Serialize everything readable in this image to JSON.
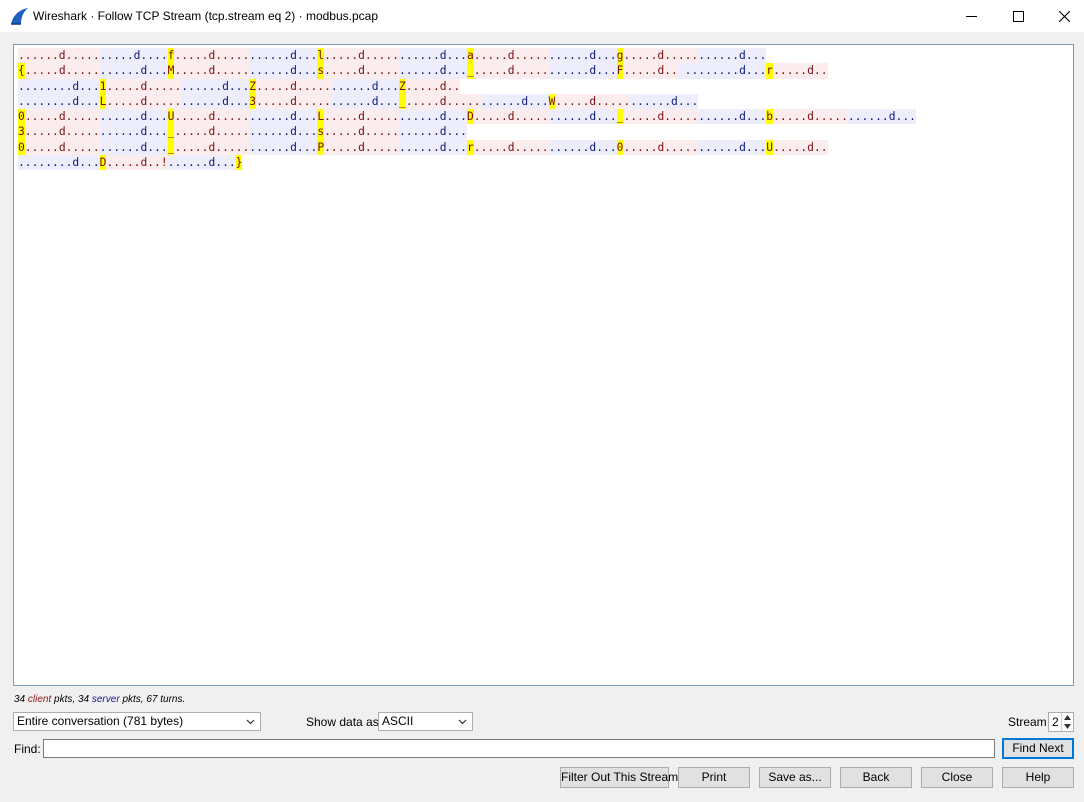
{
  "window": {
    "title": "Wireshark · Follow TCP Stream (tcp.stream eq 2) · modbus.pcap",
    "brand_color": "#1f5fbf"
  },
  "stream": {
    "lines": [
      [
        {
          "d": "c",
          "t": "......d....."
        },
        {
          "d": "s",
          "t": ".....d...."
        },
        {
          "d": "c",
          "t": "f"
        },
        {
          "d": "c",
          "t": ".....d....."
        },
        {
          "d": "s",
          "t": "......d..."
        },
        {
          "d": "c",
          "t": "l"
        },
        {
          "d": "c",
          "t": ".....d....."
        },
        {
          "d": "s",
          "t": "......d..."
        },
        {
          "d": "c",
          "t": "a"
        },
        {
          "d": "c",
          "t": ".....d....."
        },
        {
          "d": "s",
          "t": "......d..."
        },
        {
          "d": "c",
          "t": "g"
        },
        {
          "d": "c",
          "t": ".....d....."
        },
        {
          "d": "s",
          "t": "......d..."
        }
      ],
      [
        {
          "d": "c",
          "t": "{"
        },
        {
          "d": "c",
          "t": ".....d....."
        },
        {
          "d": "s",
          "t": "......d..."
        },
        {
          "d": "c",
          "t": "M"
        },
        {
          "d": "c",
          "t": ".....d....."
        },
        {
          "d": "s",
          "t": "......d..."
        },
        {
          "d": "c",
          "t": "s"
        },
        {
          "d": "c",
          "t": ".....d....."
        },
        {
          "d": "s",
          "t": "......d..."
        },
        {
          "d": "c",
          "t": "_"
        },
        {
          "d": "c",
          "t": ".....d....."
        },
        {
          "d": "s",
          "t": "......d..."
        },
        {
          "d": "c",
          "t": "F"
        },
        {
          "d": "c",
          "t": ".....d.."
        },
        {
          "d": "s",
          "t": " ........d..."
        },
        {
          "d": "c",
          "t": "r"
        },
        {
          "d": "c",
          "t": ".....d.."
        }
      ],
      [
        {
          "d": "s",
          "t": "........d..."
        },
        {
          "d": "c",
          "t": "1"
        },
        {
          "d": "c",
          "t": ".....d....."
        },
        {
          "d": "s",
          "t": "......d..."
        },
        {
          "d": "c",
          "t": "Z"
        },
        {
          "d": "c",
          "t": ".....d....."
        },
        {
          "d": "s",
          "t": "......d..."
        },
        {
          "d": "c",
          "t": "Z"
        },
        {
          "d": "c",
          "t": ".....d.."
        }
      ],
      [
        {
          "d": "s",
          "t": "........d..."
        },
        {
          "d": "c",
          "t": "L"
        },
        {
          "d": "c",
          "t": ".....d....."
        },
        {
          "d": "s",
          "t": "......d..."
        },
        {
          "d": "c",
          "t": "3"
        },
        {
          "d": "c",
          "t": ".....d....."
        },
        {
          "d": "s",
          "t": "......d..."
        },
        {
          "d": "c",
          "t": "_"
        },
        {
          "d": "c",
          "t": ".....d....."
        },
        {
          "d": "s",
          "t": "......d..."
        },
        {
          "d": "c",
          "t": "W"
        },
        {
          "d": "c",
          "t": ".....d....."
        },
        {
          "d": "s",
          "t": "......d..."
        }
      ],
      [
        {
          "d": "c",
          "t": "0"
        },
        {
          "d": "c",
          "t": ".....d....."
        },
        {
          "d": "s",
          "t": "......d..."
        },
        {
          "d": "c",
          "t": "U"
        },
        {
          "d": "c",
          "t": ".....d....."
        },
        {
          "d": "s",
          "t": "......d..."
        },
        {
          "d": "c",
          "t": "L"
        },
        {
          "d": "c",
          "t": ".....d....."
        },
        {
          "d": "s",
          "t": "......d..."
        },
        {
          "d": "c",
          "t": "D"
        },
        {
          "d": "c",
          "t": ".....d....."
        },
        {
          "d": "s",
          "t": "......d..."
        },
        {
          "d": "c",
          "t": "_"
        },
        {
          "d": "c",
          "t": ".....d....."
        },
        {
          "d": "s",
          "t": "......d..."
        },
        {
          "d": "c",
          "t": "b"
        },
        {
          "d": "c",
          "t": ".....d....."
        },
        {
          "d": "s",
          "t": "......d..."
        }
      ],
      [
        {
          "d": "c",
          "t": "3"
        },
        {
          "d": "c",
          "t": ".....d....."
        },
        {
          "d": "s",
          "t": "......d..."
        },
        {
          "d": "c",
          "t": "_"
        },
        {
          "d": "c",
          "t": ".....d....."
        },
        {
          "d": "s",
          "t": "......d..."
        },
        {
          "d": "c",
          "t": "s"
        },
        {
          "d": "c",
          "t": ".....d....."
        },
        {
          "d": "s",
          "t": "......d..."
        }
      ],
      [
        {
          "d": "c",
          "t": "0"
        },
        {
          "d": "c",
          "t": ".....d....."
        },
        {
          "d": "s",
          "t": "......d..."
        },
        {
          "d": "c",
          "t": "_"
        },
        {
          "d": "c",
          "t": ".....d....."
        },
        {
          "d": "s",
          "t": "......d..."
        },
        {
          "d": "c",
          "t": "P"
        },
        {
          "d": "c",
          "t": ".....d....."
        },
        {
          "d": "s",
          "t": "......d..."
        },
        {
          "d": "c",
          "t": "r"
        },
        {
          "d": "c",
          "t": ".....d....."
        },
        {
          "d": "s",
          "t": "......d..."
        },
        {
          "d": "c",
          "t": "0"
        },
        {
          "d": "c",
          "t": ".....d....."
        },
        {
          "d": "s",
          "t": "......d..."
        },
        {
          "d": "c",
          "t": "U"
        },
        {
          "d": "c",
          "t": ".....d.."
        }
      ],
      [
        {
          "d": "s",
          "t": "........d..."
        },
        {
          "d": "c",
          "t": "D"
        },
        {
          "d": "c",
          "t": ".....d..!"
        },
        {
          "d": "s",
          "t": "......d..."
        },
        {
          "d": "c",
          "t": "}"
        }
      ]
    ],
    "highlight_chars": [
      "f",
      "l",
      "a",
      "g",
      "{",
      "M",
      "s",
      "_",
      "F",
      "r",
      "1",
      "Z",
      "L",
      "3",
      "W",
      "0",
      "U",
      "D",
      "b",
      "P",
      "}"
    ],
    "client_color": "#7a0f12",
    "client_bg": "#fbeded",
    "server_color": "#0f1a7a",
    "server_bg": "#ededfb",
    "highlight_color": "#ffff00"
  },
  "stats": {
    "client_count": "34",
    "client_word": "client",
    "client_suffix": "pkts,",
    "server_count": "34",
    "server_word": "server",
    "server_suffix": "pkts, 67 turns."
  },
  "controls": {
    "conversation_select": "Entire conversation (781 bytes)",
    "show_data_label": "Show data as",
    "show_data_select": "ASCII",
    "stream_label": "Stream",
    "stream_value": "2",
    "find_label": "Find:",
    "find_value": "",
    "find_next_label": "Find Next"
  },
  "buttons": {
    "filter_out": "Filter Out This Stream",
    "print": "Print",
    "save_as": "Save as...",
    "back": "Back",
    "close": "Close",
    "help": "Help"
  }
}
